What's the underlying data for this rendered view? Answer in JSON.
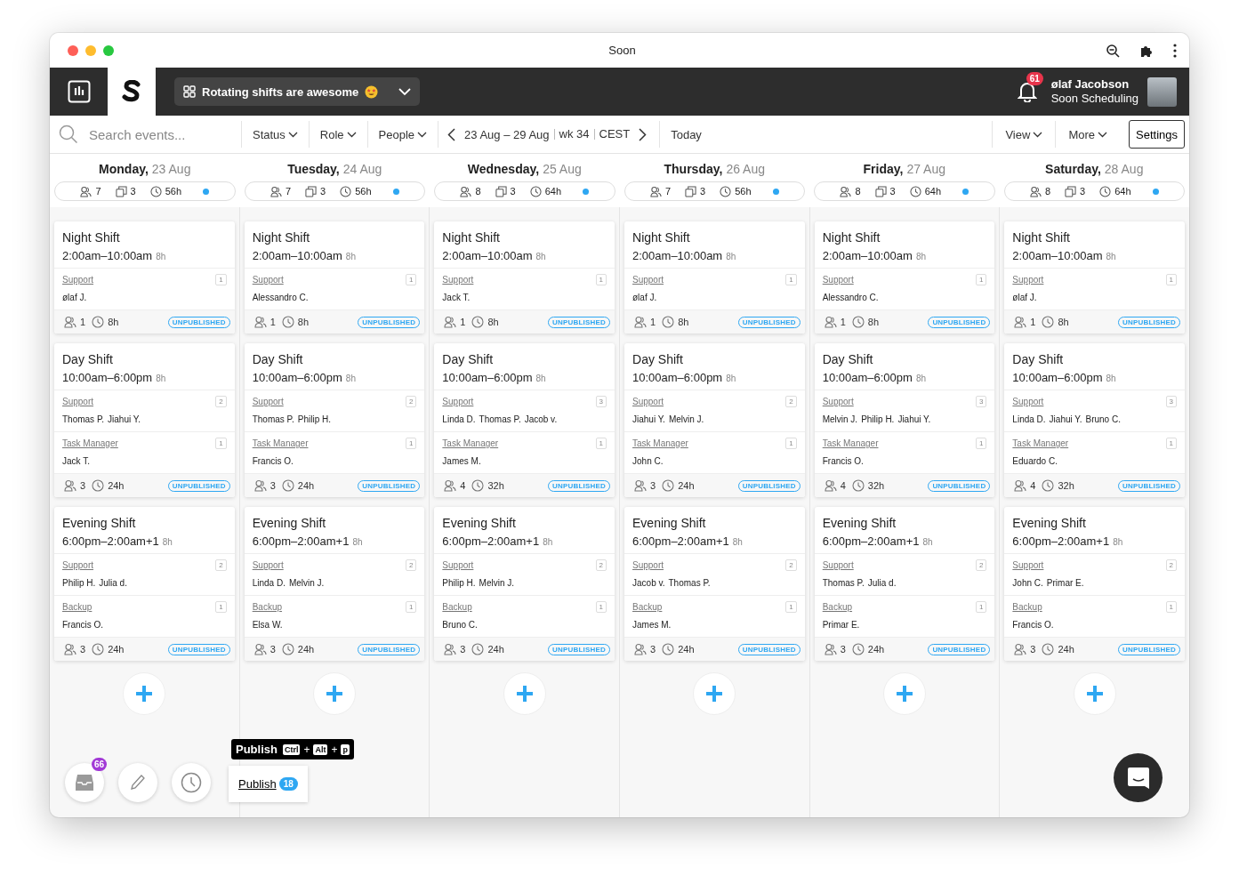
{
  "window": {
    "title": "Soon"
  },
  "header": {
    "banner": "Rotating shifts are awesome",
    "notifications": "61",
    "user_name": "ølaf Jacobson",
    "organization": "Soon Scheduling"
  },
  "toolbar": {
    "search": {
      "placeholder": "Search events..."
    },
    "filters": [
      "Status",
      "Role",
      "People"
    ],
    "range": "23 Aug – 29 Aug",
    "week": "wk 34",
    "timezone": "CEST",
    "today": "Today",
    "menus": [
      "View",
      "More"
    ],
    "settings": "Settings"
  },
  "days": [
    {
      "weekday": "Monday,",
      "date": "23 Aug",
      "people": "7",
      "shifts": "3",
      "hours": "56h",
      "events": [
        {
          "title": "Night Shift",
          "time": "2:00am–10:00am",
          "duration": "8h",
          "roles": [
            {
              "role": "Support",
              "count": "1",
              "people": [
                "ølaf J."
              ]
            }
          ],
          "staff": "1",
          "hours": "8h",
          "status": "UNPUBLISHED"
        },
        {
          "title": "Day Shift",
          "time": "10:00am–6:00pm",
          "duration": "8h",
          "roles": [
            {
              "role": "Support",
              "count": "2",
              "people": [
                "Thomas P.",
                "Jiahui Y."
              ]
            },
            {
              "role": "Task Manager",
              "count": "1",
              "people": [
                "Jack T."
              ]
            }
          ],
          "staff": "3",
          "hours": "24h",
          "status": "UNPUBLISHED"
        },
        {
          "title": "Evening Shift",
          "time": "6:00pm–2:00am+1",
          "duration": "8h",
          "roles": [
            {
              "role": "Support",
              "count": "2",
              "people": [
                "Philip H.",
                "Julia d."
              ]
            },
            {
              "role": "Backup",
              "count": "1",
              "people": [
                "Francis O."
              ]
            }
          ],
          "staff": "3",
          "hours": "24h",
          "status": "UNPUBLISHED"
        }
      ]
    },
    {
      "weekday": "Tuesday,",
      "date": "24 Aug",
      "people": "7",
      "shifts": "3",
      "hours": "56h",
      "events": [
        {
          "title": "Night Shift",
          "time": "2:00am–10:00am",
          "duration": "8h",
          "roles": [
            {
              "role": "Support",
              "count": "1",
              "people": [
                "Alessandro C."
              ]
            }
          ],
          "staff": "1",
          "hours": "8h",
          "status": "UNPUBLISHED"
        },
        {
          "title": "Day Shift",
          "time": "10:00am–6:00pm",
          "duration": "8h",
          "roles": [
            {
              "role": "Support",
              "count": "2",
              "people": [
                "Thomas P.",
                "Philip H."
              ]
            },
            {
              "role": "Task Manager",
              "count": "1",
              "people": [
                "Francis O."
              ]
            }
          ],
          "staff": "3",
          "hours": "24h",
          "status": "UNPUBLISHED"
        },
        {
          "title": "Evening Shift",
          "time": "6:00pm–2:00am+1",
          "duration": "8h",
          "roles": [
            {
              "role": "Support",
              "count": "2",
              "people": [
                "Linda D.",
                "Melvin J."
              ]
            },
            {
              "role": "Backup",
              "count": "1",
              "people": [
                "Elsa W."
              ]
            }
          ],
          "staff": "3",
          "hours": "24h",
          "status": "UNPUBLISHED"
        }
      ]
    },
    {
      "weekday": "Wednesday,",
      "date": "25 Aug",
      "people": "8",
      "shifts": "3",
      "hours": "64h",
      "events": [
        {
          "title": "Night Shift",
          "time": "2:00am–10:00am",
          "duration": "8h",
          "roles": [
            {
              "role": "Support",
              "count": "1",
              "people": [
                "Jack T."
              ]
            }
          ],
          "staff": "1",
          "hours": "8h",
          "status": "UNPUBLISHED"
        },
        {
          "title": "Day Shift",
          "time": "10:00am–6:00pm",
          "duration": "8h",
          "roles": [
            {
              "role": "Support",
              "count": "3",
              "people": [
                "Linda D.",
                "Thomas P.",
                "Jacob v."
              ]
            },
            {
              "role": "Task Manager",
              "count": "1",
              "people": [
                "James M."
              ]
            }
          ],
          "staff": "4",
          "hours": "32h",
          "status": "UNPUBLISHED"
        },
        {
          "title": "Evening Shift",
          "time": "6:00pm–2:00am+1",
          "duration": "8h",
          "roles": [
            {
              "role": "Support",
              "count": "2",
              "people": [
                "Philip H.",
                "Melvin J."
              ]
            },
            {
              "role": "Backup",
              "count": "1",
              "people": [
                "Bruno C."
              ]
            }
          ],
          "staff": "3",
          "hours": "24h",
          "status": "UNPUBLISHED"
        }
      ]
    },
    {
      "weekday": "Thursday,",
      "date": "26 Aug",
      "people": "7",
      "shifts": "3",
      "hours": "56h",
      "events": [
        {
          "title": "Night Shift",
          "time": "2:00am–10:00am",
          "duration": "8h",
          "roles": [
            {
              "role": "Support",
              "count": "1",
              "people": [
                "ølaf J."
              ]
            }
          ],
          "staff": "1",
          "hours": "8h",
          "status": "UNPUBLISHED"
        },
        {
          "title": "Day Shift",
          "time": "10:00am–6:00pm",
          "duration": "8h",
          "roles": [
            {
              "role": "Support",
              "count": "2",
              "people": [
                "Jiahui Y.",
                "Melvin J."
              ]
            },
            {
              "role": "Task Manager",
              "count": "1",
              "people": [
                "John C."
              ]
            }
          ],
          "staff": "3",
          "hours": "24h",
          "status": "UNPUBLISHED"
        },
        {
          "title": "Evening Shift",
          "time": "6:00pm–2:00am+1",
          "duration": "8h",
          "roles": [
            {
              "role": "Support",
              "count": "2",
              "people": [
                "Jacob v.",
                "Thomas P."
              ]
            },
            {
              "role": "Backup",
              "count": "1",
              "people": [
                "James M."
              ]
            }
          ],
          "staff": "3",
          "hours": "24h",
          "status": "UNPUBLISHED"
        }
      ]
    },
    {
      "weekday": "Friday,",
      "date": "27 Aug",
      "people": "8",
      "shifts": "3",
      "hours": "64h",
      "events": [
        {
          "title": "Night Shift",
          "time": "2:00am–10:00am",
          "duration": "8h",
          "roles": [
            {
              "role": "Support",
              "count": "1",
              "people": [
                "Alessandro C."
              ]
            }
          ],
          "staff": "1",
          "hours": "8h",
          "status": "UNPUBLISHED"
        },
        {
          "title": "Day Shift",
          "time": "10:00am–6:00pm",
          "duration": "8h",
          "roles": [
            {
              "role": "Support",
              "count": "3",
              "people": [
                "Melvin J.",
                "Philip H.",
                "Jiahui Y."
              ]
            },
            {
              "role": "Task Manager",
              "count": "1",
              "people": [
                "Francis O."
              ]
            }
          ],
          "staff": "4",
          "hours": "32h",
          "status": "UNPUBLISHED"
        },
        {
          "title": "Evening Shift",
          "time": "6:00pm–2:00am+1",
          "duration": "8h",
          "roles": [
            {
              "role": "Support",
              "count": "2",
              "people": [
                "Thomas P.",
                "Julia d."
              ]
            },
            {
              "role": "Backup",
              "count": "1",
              "people": [
                "Primar E."
              ]
            }
          ],
          "staff": "3",
          "hours": "24h",
          "status": "UNPUBLISHED"
        }
      ]
    },
    {
      "weekday": "Saturday,",
      "date": "28 Aug",
      "people": "8",
      "shifts": "3",
      "hours": "64h",
      "events": [
        {
          "title": "Night Shift",
          "time": "2:00am–10:00am",
          "duration": "8h",
          "roles": [
            {
              "role": "Support",
              "count": "1",
              "people": [
                "ølaf J."
              ]
            }
          ],
          "staff": "1",
          "hours": "8h",
          "status": "UNPUBLISHED"
        },
        {
          "title": "Day Shift",
          "time": "10:00am–6:00pm",
          "duration": "8h",
          "roles": [
            {
              "role": "Support",
              "count": "3",
              "people": [
                "Linda D.",
                "Jiahui Y.",
                "Bruno C."
              ]
            },
            {
              "role": "Task Manager",
              "count": "1",
              "people": [
                "Eduardo C."
              ]
            }
          ],
          "staff": "4",
          "hours": "32h",
          "status": "UNPUBLISHED"
        },
        {
          "title": "Evening Shift",
          "time": "6:00pm–2:00am+1",
          "duration": "8h",
          "roles": [
            {
              "role": "Support",
              "count": "2",
              "people": [
                "John C.",
                "Primar E."
              ]
            },
            {
              "role": "Backup",
              "count": "1",
              "people": [
                "Francis O."
              ]
            }
          ],
          "staff": "3",
          "hours": "24h",
          "status": "UNPUBLISHED"
        }
      ]
    }
  ],
  "dock": {
    "inbox_count": "66",
    "publish": {
      "label": "Publish",
      "count": "18"
    },
    "tooltip": {
      "label": "Publish",
      "keys": [
        "Ctrl",
        "Alt",
        "p"
      ],
      "separator": "+"
    }
  }
}
